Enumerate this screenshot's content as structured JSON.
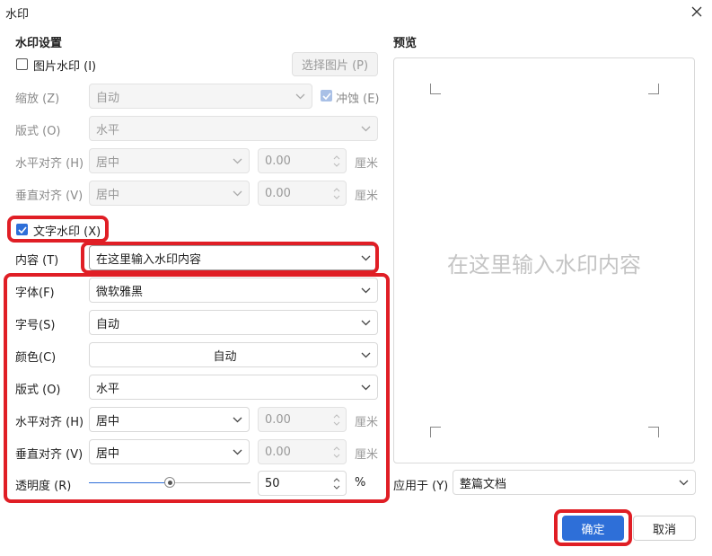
{
  "window": {
    "title": "水印",
    "close_icon": "close-icon"
  },
  "image_watermark": {
    "section_title": "水印设置",
    "checkbox_label": "图片水印 (I)",
    "checked": false,
    "select_picture_button": "选择图片 (P)",
    "scale": {
      "label": "缩放 (Z)",
      "value": "自动"
    },
    "washout": {
      "label": "冲蚀 (E)",
      "checked": true
    },
    "layout": {
      "label": "版式 (O)",
      "value": "水平"
    },
    "h_align": {
      "label": "水平对齐 (H)",
      "value": "居中",
      "offset": "0.00",
      "unit": "厘米"
    },
    "v_align": {
      "label": "垂直对齐 (V)",
      "value": "居中",
      "offset": "0.00",
      "unit": "厘米"
    }
  },
  "text_watermark": {
    "checkbox_label": "文字水印 (X)",
    "checked": true,
    "content": {
      "label": "内容 (T)",
      "value": "在这里输入水印内容"
    },
    "font": {
      "label": "字体(F)",
      "value": "微软雅黑"
    },
    "size": {
      "label": "字号(S)",
      "value": "自动"
    },
    "color": {
      "label": "颜色(C)",
      "value": "自动"
    },
    "layout": {
      "label": "版式 (O)",
      "value": "水平"
    },
    "h_align": {
      "label": "水平对齐 (H)",
      "value": "居中",
      "offset": "0.00",
      "unit": "厘米"
    },
    "v_align": {
      "label": "垂直对齐 (V)",
      "value": "居中",
      "offset": "0.00",
      "unit": "厘米"
    },
    "transparency": {
      "label": "透明度 (R)",
      "value": "50",
      "unit": "%",
      "slider_fraction": 0.5
    }
  },
  "preview": {
    "title": "预览",
    "text": "在这里输入水印内容"
  },
  "apply_to": {
    "label": "应用于 (Y)",
    "value": "整篇文档"
  },
  "buttons": {
    "ok": "确定",
    "cancel": "取消"
  },
  "colors": {
    "accent": "#2e6fd8",
    "highlight": "#e01e25"
  }
}
